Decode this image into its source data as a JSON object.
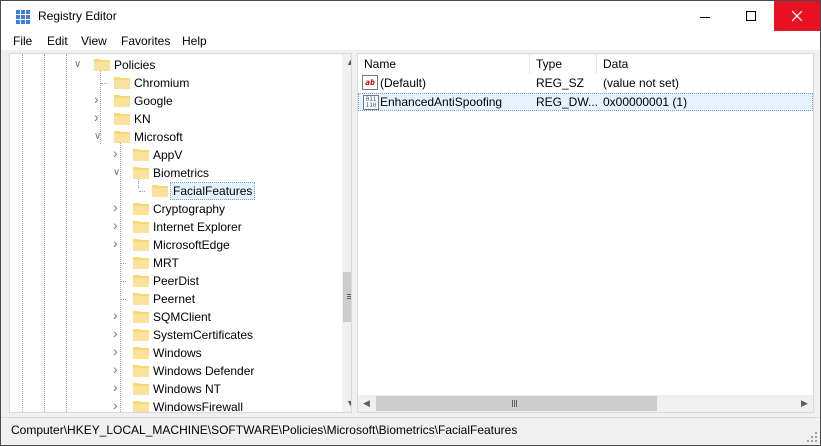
{
  "window": {
    "title": "Registry Editor"
  },
  "menu": [
    "File",
    "Edit",
    "View",
    "Favorites",
    "Help"
  ],
  "tree": {
    "items": [
      {
        "label": "Policies",
        "expanded": true
      },
      {
        "label": "Chromium",
        "expanded": null
      },
      {
        "label": "Google",
        "expanded": false
      },
      {
        "label": "KN",
        "expanded": false
      },
      {
        "label": "Microsoft",
        "expanded": true
      },
      {
        "label": "AppV",
        "expanded": false
      },
      {
        "label": "Biometrics",
        "expanded": true
      },
      {
        "label": "FacialFeatures",
        "expanded": null,
        "selected": true
      },
      {
        "label": "Cryptography",
        "expanded": false
      },
      {
        "label": "Internet Explorer",
        "expanded": false
      },
      {
        "label": "MicrosoftEdge",
        "expanded": false
      },
      {
        "label": "MRT",
        "expanded": null
      },
      {
        "label": "PeerDist",
        "expanded": null
      },
      {
        "label": "Peernet",
        "expanded": null
      },
      {
        "label": "SQMClient",
        "expanded": false
      },
      {
        "label": "SystemCertificates",
        "expanded": false
      },
      {
        "label": "Windows",
        "expanded": false
      },
      {
        "label": "Windows Defender",
        "expanded": false
      },
      {
        "label": "Windows NT",
        "expanded": false
      },
      {
        "label": "WindowsFirewall",
        "expanded": false
      }
    ]
  },
  "list": {
    "columns": [
      "Name",
      "Type",
      "Data"
    ],
    "rows": [
      {
        "name": "(Default)",
        "type": "REG_SZ",
        "data": "(value not set)",
        "icon": "reg-sz-icon"
      },
      {
        "name": "EnhancedAntiSpoofing",
        "type": "REG_DW...",
        "data": "0x00000001 (1)",
        "icon": "reg-dword-icon",
        "selected": true
      }
    ]
  },
  "status": {
    "path": "Computer\\HKEY_LOCAL_MACHINE\\SOFTWARE\\Policies\\Microsoft\\Biometrics\\FacialFeatures"
  },
  "colors": {
    "folder": "#f8d775",
    "close": "#e81123",
    "selection": "#e5f3ff"
  }
}
